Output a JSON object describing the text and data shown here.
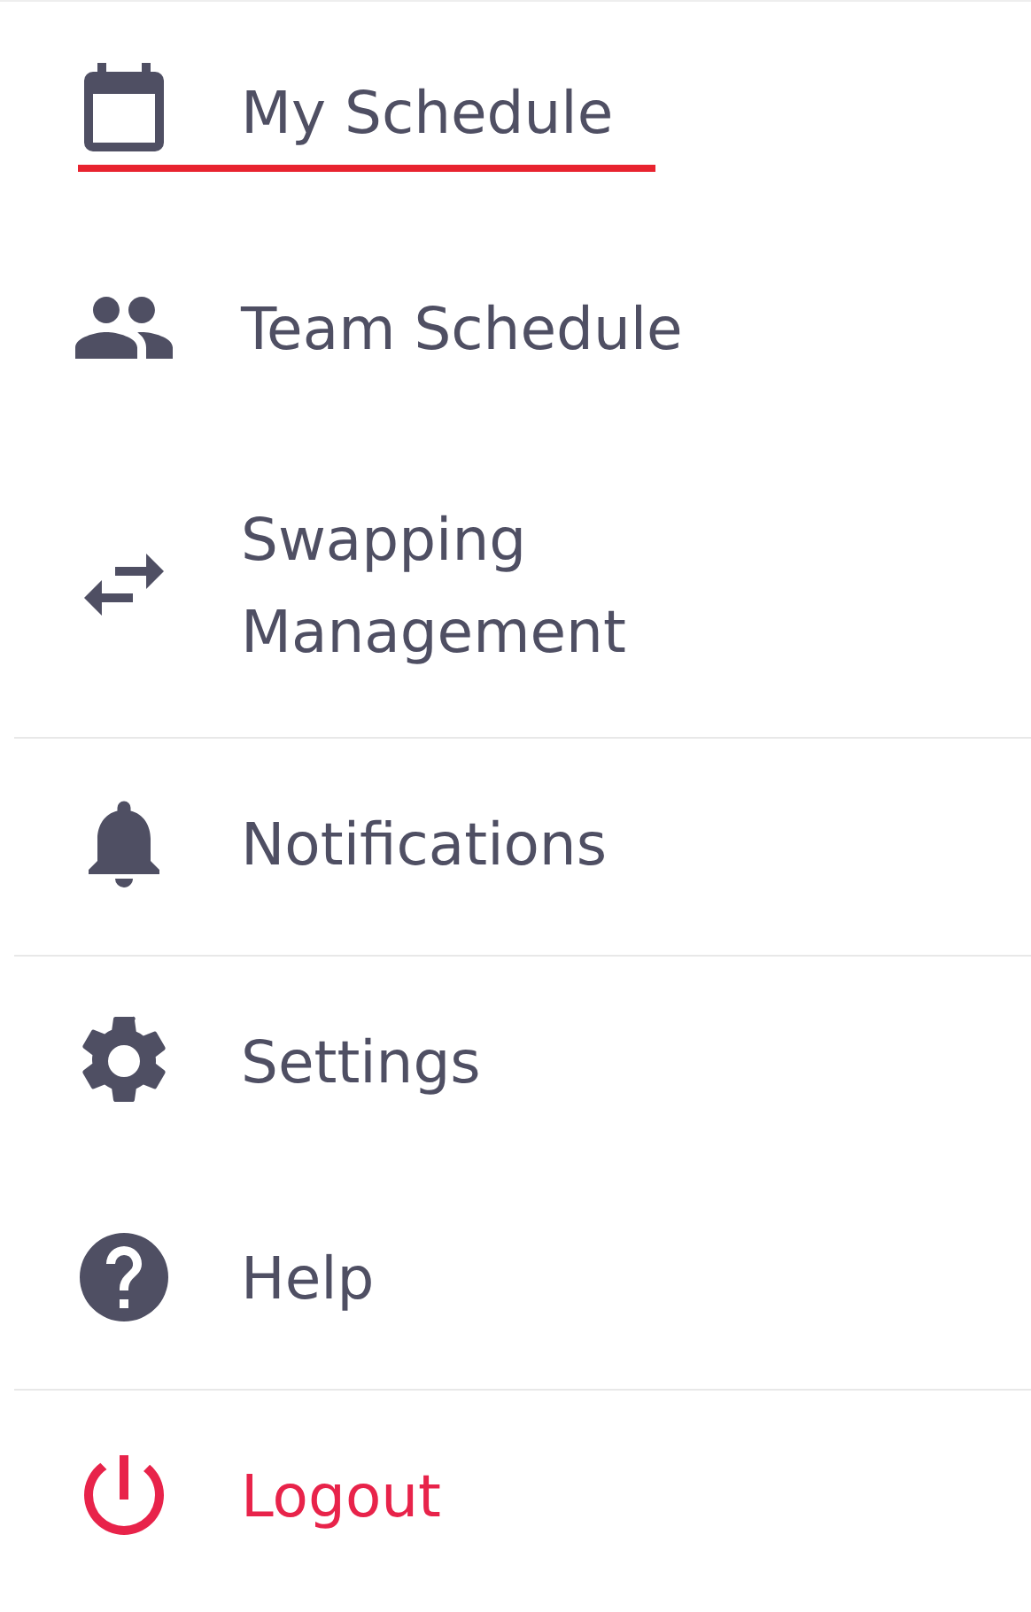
{
  "menu": {
    "sections": [
      {
        "items": [
          {
            "label": "My Schedule",
            "selected": true,
            "color": "#4f4f63"
          },
          {
            "label": "Team Schedule",
            "selected": false,
            "color": "#4f4f63"
          },
          {
            "label": "Swapping Management",
            "selected": false,
            "color": "#4f4f63"
          }
        ]
      },
      {
        "items": [
          {
            "label": "Notifications",
            "selected": false,
            "color": "#4f4f63"
          }
        ]
      },
      {
        "items": [
          {
            "label": "Settings",
            "selected": false,
            "color": "#4f4f63"
          },
          {
            "label": "Help",
            "selected": false,
            "color": "#4f4f63"
          }
        ]
      },
      {
        "items": [
          {
            "label": "Logout",
            "selected": false,
            "color": "#e8234a"
          }
        ]
      }
    ]
  }
}
